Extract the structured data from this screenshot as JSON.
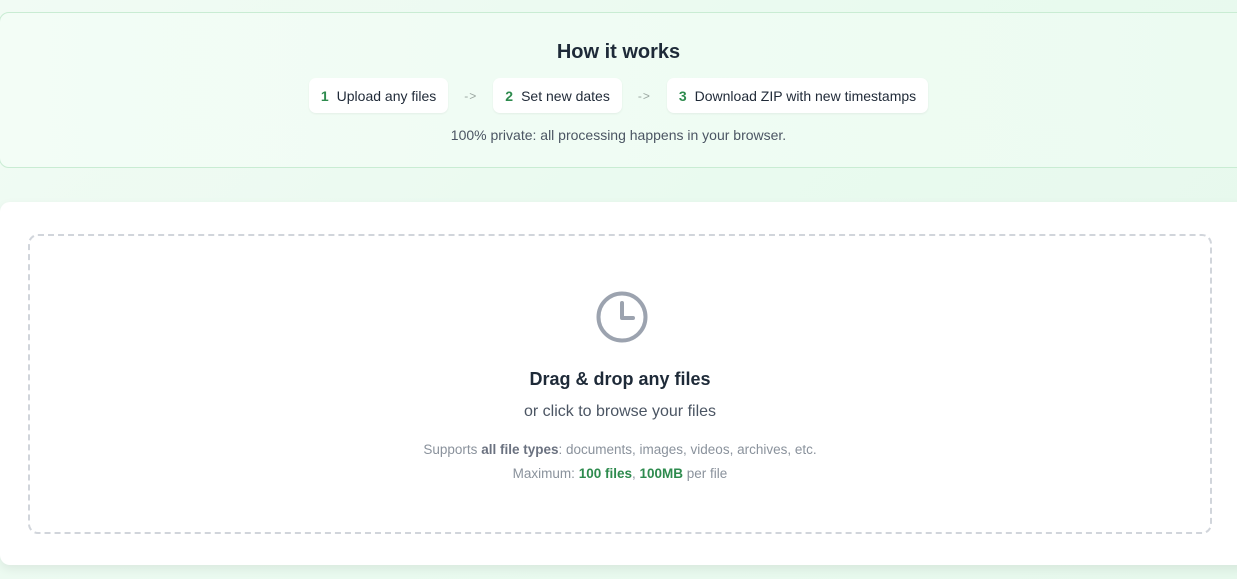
{
  "how_it_works": {
    "title": "How it works",
    "steps": [
      {
        "number": "1",
        "label": "Upload any files"
      },
      {
        "number": "2",
        "label": "Set new dates"
      },
      {
        "number": "3",
        "label": "Download ZIP with new timestamps"
      }
    ],
    "arrow": "->",
    "privacy_note": "100% private: all processing happens in your browser."
  },
  "dropzone": {
    "icon": "clock-icon",
    "title": "Drag & drop any files",
    "subtitle": "or click to browse your files",
    "supports_prefix": "Supports ",
    "supports_strong": "all file types",
    "supports_suffix": ": documents, images, videos, archives, etc.",
    "max_prefix": "Maximum: ",
    "max_files": "100 files",
    "max_separator": ", ",
    "max_size": "100MB",
    "max_suffix": " per file"
  },
  "colors": {
    "accent_green": "#2e8b4e",
    "panel_border": "#c9ecd3",
    "dashed_border": "#d1d5db",
    "icon_gray": "#9ca3af"
  }
}
